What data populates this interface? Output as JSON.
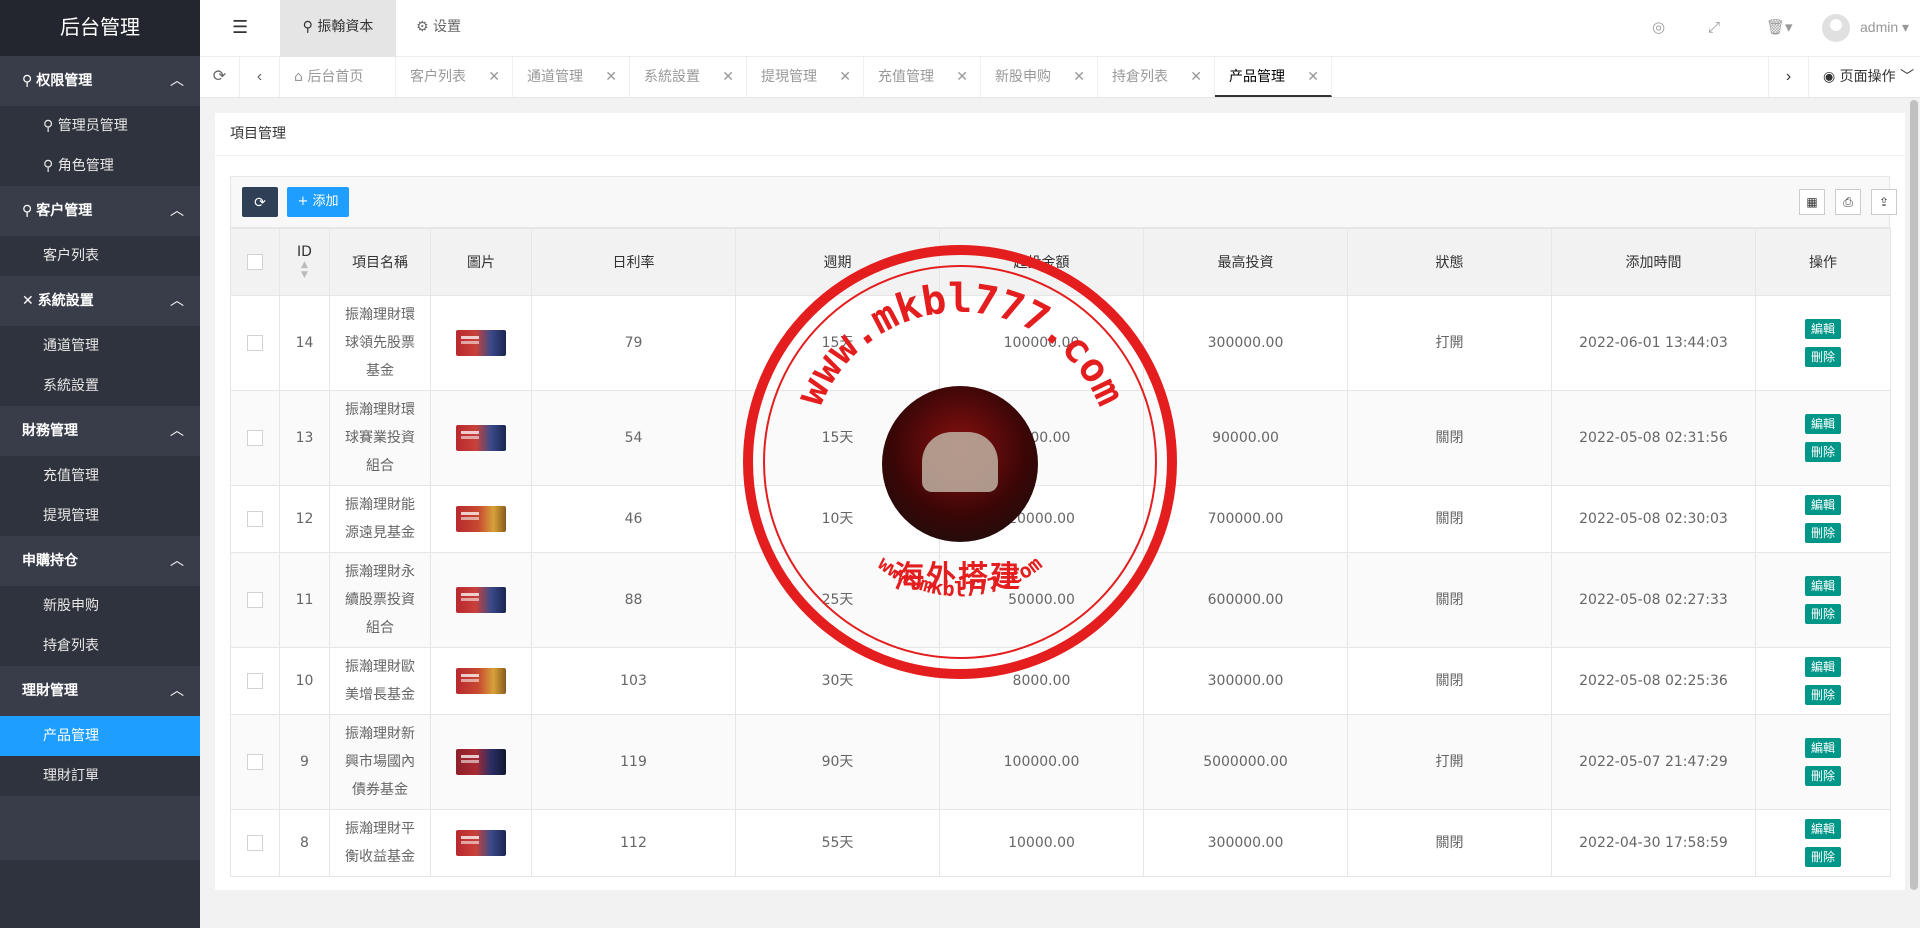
{
  "sidebar": {
    "logo": "后台管理",
    "groups": [
      {
        "title": "权限管理",
        "icon": "user-icon",
        "items": [
          "管理员管理",
          "角色管理"
        ]
      },
      {
        "title": "客户管理",
        "icon": "user-icon",
        "items": [
          "客户列表"
        ]
      },
      {
        "title": "系統設置",
        "icon": "wrench-icon",
        "items": [
          "通道管理",
          "系統設置"
        ]
      },
      {
        "title": "財務管理",
        "icon": "",
        "items": [
          "充值管理",
          "提現管理"
        ]
      },
      {
        "title": "申購持仓",
        "icon": "",
        "items": [
          "新股申购",
          "持倉列表"
        ]
      },
      {
        "title": "理財管理",
        "icon": "",
        "items": [
          "产品管理",
          "理財訂單"
        ]
      }
    ],
    "active_item": "产品管理"
  },
  "header": {
    "tab1": "振翰資本",
    "tab2": "设置",
    "user": "admin"
  },
  "tabbar": {
    "tabs": [
      "后台首页",
      "客户列表",
      "通道管理",
      "系統設置",
      "提現管理",
      "充值管理",
      "新股申购",
      "持倉列表",
      "产品管理"
    ],
    "active": "产品管理",
    "page_ops": "页面操作"
  },
  "content": {
    "title": "項目管理",
    "add_label": "添加",
    "columns": [
      "ID",
      "項目名稱",
      "圖片",
      "日利率",
      "週期",
      "起投金額",
      "最高投資",
      "狀態",
      "添加時間",
      "操作"
    ],
    "edit_label": "編輯",
    "delete_label": "刪除",
    "rows": [
      {
        "id": "14",
        "name": "振瀚理財環球領先股票基金",
        "rate": "79",
        "period": "15天",
        "min": "100000.00",
        "max": "300000.00",
        "status": "打開",
        "time": "2022-06-01 13:44:03"
      },
      {
        "id": "13",
        "name": "振瀚理財環球賽業投資組合",
        "rate": "54",
        "period": "15天",
        "min": "1000.00",
        "max": "90000.00",
        "status": "關閉",
        "time": "2022-05-08 02:31:56"
      },
      {
        "id": "12",
        "name": "振瀚理財能源遠見基金",
        "rate": "46",
        "period": "10天",
        "min": "20000.00",
        "max": "700000.00",
        "status": "關閉",
        "time": "2022-05-08 02:30:03"
      },
      {
        "id": "11",
        "name": "振瀚理財永續股票投資組合",
        "rate": "88",
        "period": "25天",
        "min": "50000.00",
        "max": "600000.00",
        "status": "關閉",
        "time": "2022-05-08 02:27:33"
      },
      {
        "id": "10",
        "name": "振瀚理財歐美增長基金",
        "rate": "103",
        "period": "30天",
        "min": "8000.00",
        "max": "300000.00",
        "status": "關閉",
        "time": "2022-05-08 02:25:36"
      },
      {
        "id": "9",
        "name": "振瀚理財新興市場國內債券基金",
        "rate": "119",
        "period": "90天",
        "min": "100000.00",
        "max": "5000000.00",
        "status": "打開",
        "time": "2022-05-07 21:47:29"
      },
      {
        "id": "8",
        "name": "振瀚理財平衡收益基金",
        "rate": "112",
        "period": "55天",
        "min": "10000.00",
        "max": "300000.00",
        "status": "關閉",
        "time": "2022-04-30 17:58:59"
      }
    ]
  },
  "watermark": {
    "url": "www.mkbl777.com",
    "label": "海外搭建"
  },
  "colors": {
    "sidebar_bg": "#393d49",
    "active": "#1e9fff",
    "op_btn": "#009688",
    "watermark": "#e41e1e"
  }
}
